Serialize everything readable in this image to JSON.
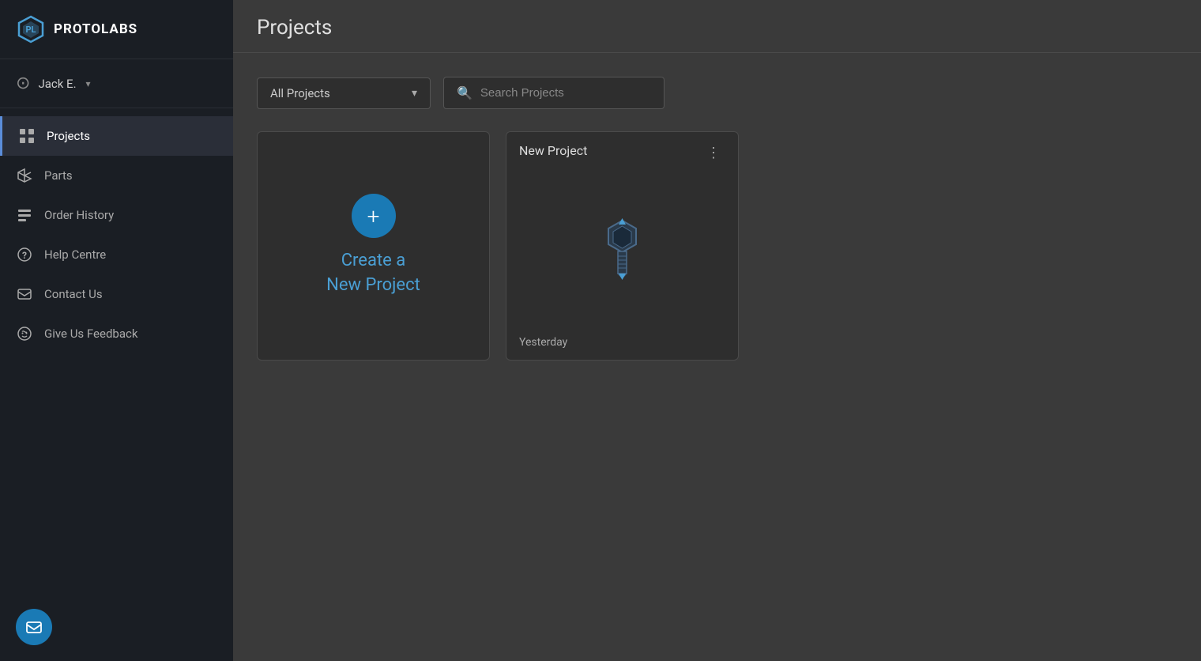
{
  "logo": {
    "text": "PROTOLABS"
  },
  "user": {
    "name": "Jack E.",
    "chevron": "▾"
  },
  "sidebar": {
    "items": [
      {
        "id": "projects",
        "label": "Projects",
        "icon": "grid",
        "active": true
      },
      {
        "id": "parts",
        "label": "Parts",
        "icon": "parts",
        "active": false
      },
      {
        "id": "order-history",
        "label": "Order History",
        "icon": "history",
        "active": false
      },
      {
        "id": "help-centre",
        "label": "Help Centre",
        "icon": "help",
        "active": false
      },
      {
        "id": "contact-us",
        "label": "Contact Us",
        "icon": "contact",
        "active": false
      },
      {
        "id": "give-feedback",
        "label": "Give Us Feedback",
        "icon": "feedback",
        "active": false
      }
    ]
  },
  "page": {
    "title": "Projects"
  },
  "filter": {
    "label": "All Projects",
    "placeholder": "Search Projects"
  },
  "cards": {
    "create": {
      "label_line1": "Create a",
      "label_line2": "New Project"
    },
    "new_project": {
      "name": "New Project",
      "date": "Yesterday"
    }
  },
  "colors": {
    "accent": "#4a9fd4",
    "accent_dark": "#1a7ab5",
    "sidebar_bg": "#1a1e24",
    "active_bg": "#2a2e38"
  }
}
